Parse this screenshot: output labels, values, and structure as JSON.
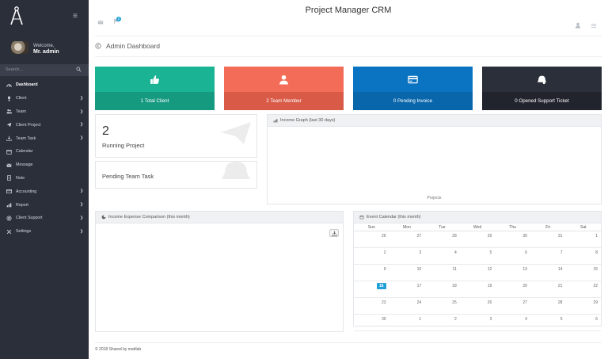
{
  "app_title": "Project Manager CRM",
  "sidebar": {
    "welcome": "Welcome,",
    "admin_name": "Mr. admin",
    "search_placeholder": "Search...",
    "items": [
      {
        "label": "Dashboard",
        "icon": "dashboard-icon",
        "active": true,
        "chevron": false
      },
      {
        "label": "Client",
        "icon": "trophy-icon",
        "active": false,
        "chevron": true
      },
      {
        "label": "Team",
        "icon": "users-icon",
        "active": false,
        "chevron": true
      },
      {
        "label": "Client Project",
        "icon": "send-icon",
        "active": false,
        "chevron": true
      },
      {
        "label": "Team Task",
        "icon": "download-tray-icon",
        "active": false,
        "chevron": true
      },
      {
        "label": "Calendar",
        "icon": "calendar-icon",
        "active": false,
        "chevron": false
      },
      {
        "label": "Message",
        "icon": "envelope-icon",
        "active": false,
        "chevron": false
      },
      {
        "label": "Note",
        "icon": "note-icon",
        "active": false,
        "chevron": false
      },
      {
        "label": "Accounting",
        "icon": "card-icon",
        "active": false,
        "chevron": true
      },
      {
        "label": "Report",
        "icon": "bar-chart-icon",
        "active": false,
        "chevron": true
      },
      {
        "label": "Client Support",
        "icon": "support-icon",
        "active": false,
        "chevron": true
      },
      {
        "label": "Settings",
        "icon": "tools-icon",
        "active": false,
        "chevron": true
      }
    ]
  },
  "header": {
    "notification_count": "2"
  },
  "breadcrumb": "Admin Dashboard",
  "cards": [
    {
      "label": "1 Total Client",
      "icon": "thumbs-up-icon",
      "top": "#1ab394",
      "bottom": "#159a80"
    },
    {
      "label": "2 Team Member",
      "icon": "user-icon",
      "top": "#f26c57",
      "bottom": "#d95a47"
    },
    {
      "label": "0 Pending Invoice",
      "icon": "credit-card-icon",
      "top": "#0b74c2",
      "bottom": "#0966ab"
    },
    {
      "label": "0 Opened Support Ticket",
      "icon": "ticket-icon",
      "top": "#2b2f3a",
      "bottom": "#21242d"
    }
  ],
  "running_project": {
    "count": "2",
    "label": "Running Project"
  },
  "pending_team_task": {
    "label": "Pending Team Task"
  },
  "income_graph": {
    "title": "Income Graph (last 30 days)",
    "x_label": "Projects"
  },
  "income_expense": {
    "title": "Income Expense Comparison (this month)"
  },
  "calendar": {
    "title": "Event Calendar (this month)",
    "days": [
      "Sun",
      "Mon",
      "Tue",
      "Wed",
      "Thu",
      "Fri",
      "Sat"
    ],
    "weeks": [
      [
        "26",
        "27",
        "28",
        "29",
        "30",
        "31",
        "1"
      ],
      [
        "2",
        "3",
        "4",
        "5",
        "6",
        "7",
        "8"
      ],
      [
        "9",
        "10",
        "11",
        "12",
        "13",
        "14",
        "15"
      ],
      [
        "16",
        "17",
        "18",
        "19",
        "20",
        "21",
        "22"
      ],
      [
        "23",
        "24",
        "25",
        "26",
        "27",
        "28",
        "29"
      ],
      [
        "30",
        "1",
        "2",
        "3",
        "4",
        "5",
        "6"
      ]
    ],
    "today": "16"
  },
  "footer": "© 2018 Shared by mattlab"
}
